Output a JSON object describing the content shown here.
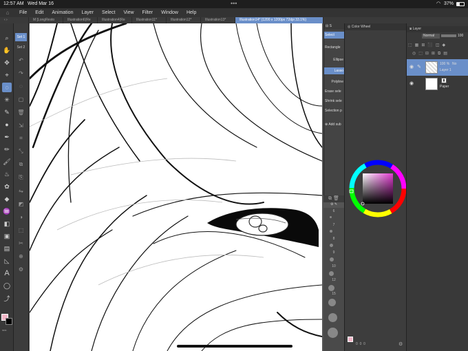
{
  "status": {
    "time": "12:57 AM",
    "date": "Wed Mar 16",
    "battery": "37%"
  },
  "menu": [
    "File",
    "Edit",
    "Animation",
    "Layer",
    "Select",
    "View",
    "Filter",
    "Window",
    "Help"
  ],
  "tabs": [
    {
      "label": "M [LongResto"
    },
    {
      "label": "Illustration6(Re"
    },
    {
      "label": "Illustration4(Re"
    },
    {
      "label": "Illustration11*"
    },
    {
      "label": "Illustration12*"
    },
    {
      "label": "Illustration13*"
    },
    {
      "label": "Illustration14* (1200 x 1200px 72dpi 33.1%)",
      "active": true
    }
  ],
  "sets": [
    "Set 1",
    "Set 2"
  ],
  "tools": [
    "hand-icon",
    "move-icon",
    "zoom-icon",
    "lasso-icon",
    "magic-wand-icon",
    "eyedropper-icon",
    "brush-icon",
    "pen-icon",
    "pencil-icon",
    "airbrush-icon",
    "decoration-icon",
    "eraser-icon",
    "blend-icon",
    "fill-icon",
    "gradient-icon",
    "figure-icon",
    "frame-icon",
    "ruler-icon",
    "text-icon",
    "balloon-icon",
    "correction-icon"
  ],
  "selection_panel": {
    "header": "Select",
    "items": [
      "Rectangle",
      "Ellipse",
      "Lasso",
      "Polyline",
      "Erase sele",
      "Shrink sele",
      "Selection p"
    ],
    "selected": "Lasso",
    "add": "Add sub"
  },
  "brush_sizes": [
    "6",
    "7",
    "8",
    "9",
    "10",
    "12",
    "15"
  ],
  "color_panel": {
    "title": "Color Wheel",
    "main_color": "#f2b6c8",
    "sub_color": "#000000"
  },
  "layer_panel": {
    "title": "Layer",
    "blend": "Normal",
    "opacity": "100",
    "layers": [
      {
        "name": "Layer 1",
        "opacity": "100 %",
        "mode": "No",
        "selected": true
      },
      {
        "name": "Paper",
        "selected": false
      }
    ]
  },
  "color_values": [
    "0",
    "0",
    "0"
  ]
}
